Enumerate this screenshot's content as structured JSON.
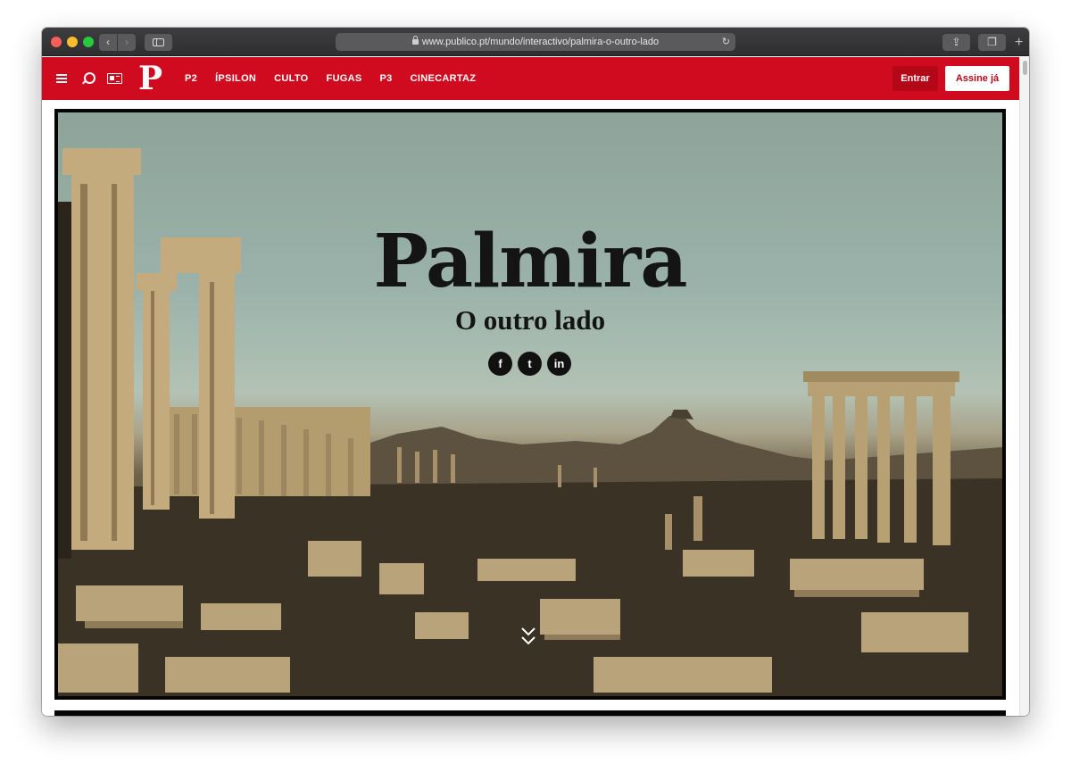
{
  "browser": {
    "url": "www.publico.pt/mundo/interactivo/palmira-o-outro-lado",
    "back_icon": "chevron-left-icon",
    "forward_icon": "chevron-right-icon"
  },
  "header": {
    "logo": "P",
    "nav": [
      "P2",
      "ÍPSILON",
      "CULTO",
      "FUGAS",
      "P3",
      "CINECARTAZ"
    ],
    "login_label": "Entrar",
    "subscribe_label": "Assine já",
    "brand_color": "#d00a1f"
  },
  "hero": {
    "title": "Palmira",
    "subtitle": "O outro lado",
    "social": [
      {
        "name": "facebook",
        "glyph": "f"
      },
      {
        "name": "twitter",
        "glyph": "t"
      },
      {
        "name": "linkedin",
        "glyph": "in"
      }
    ],
    "scroll_icon": "double-chevron-down-icon"
  }
}
